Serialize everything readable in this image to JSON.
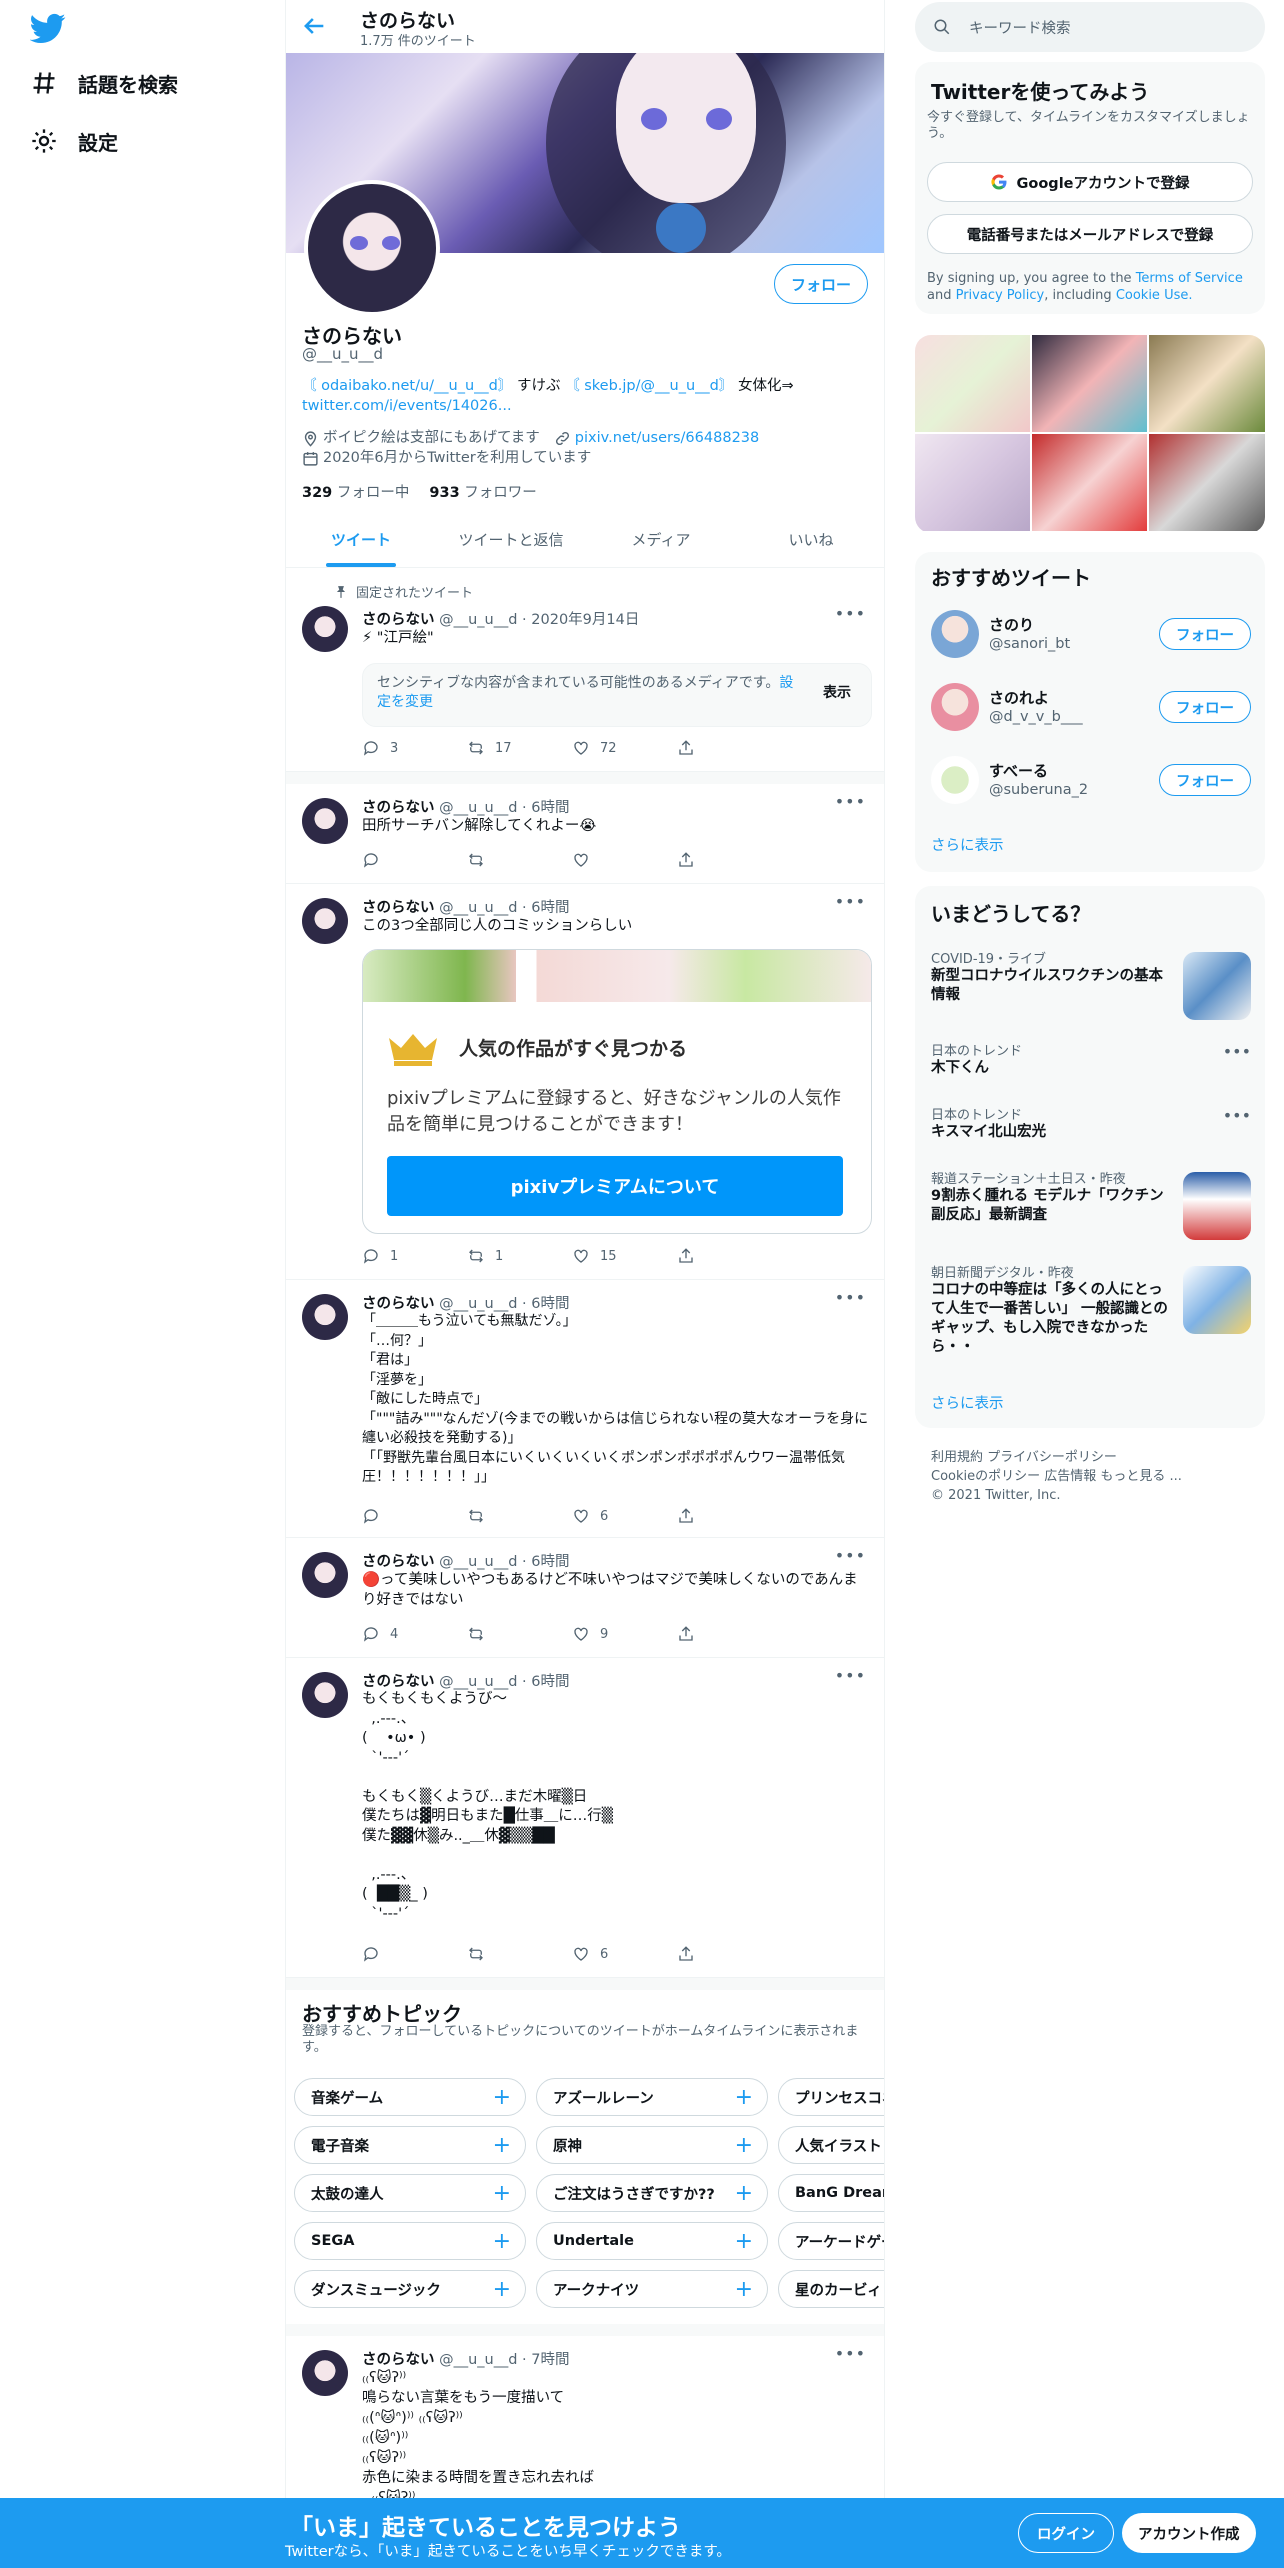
{
  "nav": {
    "search_label": "話題を検索",
    "settings_label": "設定"
  },
  "profile": {
    "name": "さのらない",
    "tweet_count": "1.7万 件のツイート",
    "handle": "@__u_u__d",
    "follow_label": "フォロー",
    "bio_line1_link1": "〘 odaibako.net/u/__u_u__d〙",
    "bio_line1_mid": "すけぶ",
    "bio_line1_link2": "〘 skeb.jp/@__u_u__d〙",
    "bio_line1_end": "女体化⇒",
    "bio_line2_link": "twitter.com/i/events/14026...",
    "location": "ボイピク絵は支部にもあげてます",
    "website": "pixiv.net/users/66488238",
    "joined": "2020年6月からTwitterを利用しています",
    "following_count": "329",
    "following_label": "フォロー中",
    "followers_count": "933",
    "followers_label": "フォロワー"
  },
  "tabs": [
    "ツイート",
    "ツイートと返信",
    "メディア",
    "いいね"
  ],
  "pinned_label": "固定されたツイート",
  "tweets": [
    {
      "name": "さのらない",
      "meta": "@__u_u__d · 2020年9月14日",
      "text": "⚡ \"江戸絵\"",
      "reply": "3",
      "retweet": "17",
      "like": "72"
    },
    {
      "name": "さのらない",
      "meta": "@__u_u__d · 6時間",
      "text": "田所サーチバン解除してくれよー😭",
      "reply": "",
      "retweet": "",
      "like": ""
    },
    {
      "name": "さのらない",
      "meta": "@__u_u__d · 6時間",
      "text": "この3つ全部同じ人のコミッションらしい",
      "reply": "1",
      "retweet": "1",
      "like": "15"
    },
    {
      "name": "さのらない",
      "meta": "@__u_u__d · 6時間",
      "text": "「＿＿＿もう泣いても無駄だゾ。」\n「…何？」\n「君は」\n「淫夢を」\n「敵にした時点で」\n「\"\"\"詰み\"\"\"なんだゾ(今までの戦いからは信じられない程の莫大なオーラを身に纏い必殺技を発動する)」\n「「野獣先輩台風日本にいくいくいくいくポンポンポポポポんウワー温帯低気圧！！！！！！！」」",
      "reply": "",
      "retweet": "",
      "like": "6"
    },
    {
      "name": "さのらない",
      "meta": "@__u_u__d · 6時間",
      "text": "🔴って美味しいやつもあるけど不味いやつはマジで美味しくないのであんまり好きではない",
      "reply": "4",
      "retweet": "",
      "like": "9"
    },
    {
      "name": "さのらない",
      "meta": "@__u_u__d · 6時間",
      "text": "もくもくもくようび～\n  ,.-‐-.、\n(    •ω• )\n  `'-‐-'´\n\nもくもく▒くようび…まだ木曜▒日\n僕たちは▓明日もまた█仕事＿に…行▒\n僕た▓▓休▒み.._＿休▓▒▒██\n\n  ,.-‐-.、\n(  ██▒_ )\n  `'-‐-'´",
      "reply": "",
      "retweet": "",
      "like": "6"
    },
    {
      "name": "さのらない",
      "meta": "@__u_u__d · 7時間",
      "text": "₍₍ʕ🐱ʔ⁾⁾\n鳴らない言葉をもう一度描いて\n₍₍(ᐢ🐱ᐢ)⁾⁾ ₍₍ʕ🐱ʔ⁾⁾\n₍₍(🐱ᐢ)⁾⁾\n₍₍ʕ🐱ʔ⁾⁾\n赤色に染まる時間を置き忘れ去れば\n  ₍₍ʕ🐱ʔ⁾⁾",
      "reply": "",
      "retweet": "",
      "like": ""
    }
  ],
  "sensitive": {
    "text": "センシティブな内容が含まれている可能性のあるメディアです。",
    "link": "設定を変更",
    "show": "表示"
  },
  "pixiv_card": {
    "title": "人気の作品がすぐ見つかる",
    "desc": "pixivプレミアムに登録すると、好きなジャンルの人気作品を簡単に見つけることができます！",
    "cta": "pixivプレミアムについて"
  },
  "topics": {
    "title": "おすすめトピック",
    "sub": "登録すると、フォローしているトピックについてのツイートがホームタイムラインに表示されます。",
    "items": [
      "音楽ゲーム",
      "アズールレーン",
      "プリンセスコネクト",
      "電子音楽",
      "原神",
      "人気イラストレータ",
      "太鼓の達人",
      "ご注文はうさぎですか??",
      "BanG Dream!",
      "SEGA",
      "Undertale",
      "アーケードゲーム",
      "ダンスミュージック",
      "アークナイツ",
      "星のカービィ"
    ]
  },
  "right": {
    "search_placeholder": "キーワード検索",
    "signup_title": "Twitterを使ってみよう",
    "signup_sub": "今すぐ登録して、タイムラインをカスタマイズしましょう。",
    "google_btn": "Googleアカウントで登録",
    "phone_btn": "電話番号またはメールアドレスで登録",
    "terms_pre": "By signing up, you agree to the ",
    "terms_tos": "Terms of Service",
    "terms_and": " and ",
    "terms_privacy": "Privacy Policy",
    "terms_including": ", including ",
    "terms_cookie": "Cookie Use.",
    "rec_title": "おすすめツイート",
    "rec": [
      {
        "name": "さのり",
        "handle": "@sanori_bt",
        "follow": "フォロー"
      },
      {
        "name": "さのれよ",
        "handle": "@d_v_v_b___",
        "follow": "フォロー"
      },
      {
        "name": "すべーる",
        "handle": "@suberuna_2",
        "follow": "フォロー"
      }
    ],
    "show_more": "さらに表示",
    "trends_title": "いまどうしてる？",
    "trends": [
      {
        "cat": "COVID-19・ライブ",
        "title": "新型コロナウイルスワクチンの基本情報"
      },
      {
        "cat": "日本のトレンド",
        "title": "木下くん"
      },
      {
        "cat": "日本のトレンド",
        "title": "キスマイ北山宏光"
      },
      {
        "cat": "報道ステーション＋土日ス・昨夜",
        "title": "9割赤く腫れる モデルナ「ワクチン副反応」最新調査"
      },
      {
        "cat": "朝日新聞デジタル・昨夜",
        "title": "コロナの中等症は「多くの人にとって人生で一番苦しい」 一般認識とのギャップ、もし入院できなかったら・・"
      }
    ],
    "footer_line1": "利用規約  プライバシーポリシー",
    "footer_line2": "Cookieのポリシー  広告情報  もっと見る ...",
    "footer_line3": "© 2021 Twitter, Inc."
  },
  "bottom": {
    "title": "「いま」起きていることを見つけよう",
    "sub": "Twitterなら、「いま」起きていることをいち早くチェックできます。",
    "login": "ログイン",
    "signup": "アカウント作成"
  }
}
